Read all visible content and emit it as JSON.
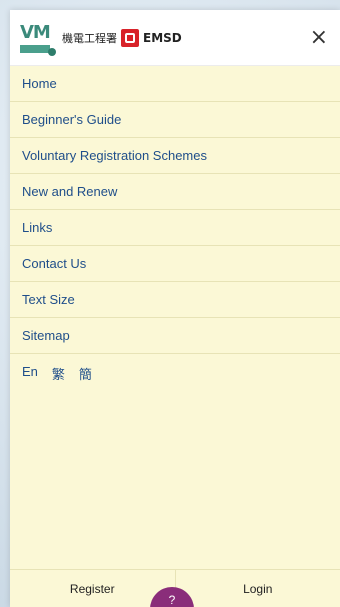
{
  "header": {
    "logo_cn": "機電工程署",
    "logo_en": "EMSD",
    "close_symbol": "×"
  },
  "menu": [
    {
      "label": "Home"
    },
    {
      "label": "Beginner's Guide"
    },
    {
      "label": "Voluntary Registration Schemes"
    },
    {
      "label": "New and Renew"
    },
    {
      "label": "Links"
    },
    {
      "label": "Contact Us"
    },
    {
      "label": "Text Size"
    },
    {
      "label": "Sitemap"
    }
  ],
  "languages": [
    "En",
    "繁",
    "簡"
  ],
  "footer": {
    "register": "Register",
    "login": "Login"
  },
  "fab": {
    "label": "?"
  }
}
